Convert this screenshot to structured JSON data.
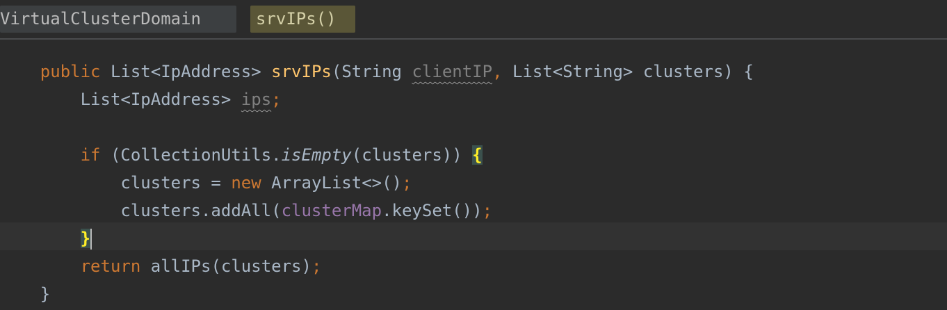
{
  "breadcrumbs": [
    {
      "label": "VirtualClusterDomain"
    },
    {
      "label": "srvIPs()"
    }
  ],
  "code": {
    "line1": {
      "kw_public": "public",
      "type": "List<IpAddress>",
      "method": "srvIPs",
      "open": "(",
      "param_type1": "String",
      "param1": "clientIP",
      "comma": ",",
      "param_type2": "List<String>",
      "param2": "clusters)",
      "open_brace": "{"
    },
    "line2": {
      "type": "List<IpAddress>",
      "var": "ips",
      "semi": ";"
    },
    "line4": {
      "kw_if": "if",
      "cond_a": "(CollectionUtils.",
      "call": "isEmpty",
      "cond_b": "(clusters))",
      "brace": "{"
    },
    "line5": {
      "lhs": "clusters = ",
      "kw_new": "new",
      "rhs": " ArrayList<>()",
      "semi": ";"
    },
    "line6": {
      "a": "clusters.addAll(",
      "field": "clusterMap",
      "b": ".keySet())",
      "semi": ";"
    },
    "line7": {
      "brace": "}"
    },
    "line8": {
      "kw_return": "return",
      "expr": " allIPs(clusters)",
      "semi": ";"
    },
    "line9": {
      "brace": "}"
    }
  }
}
